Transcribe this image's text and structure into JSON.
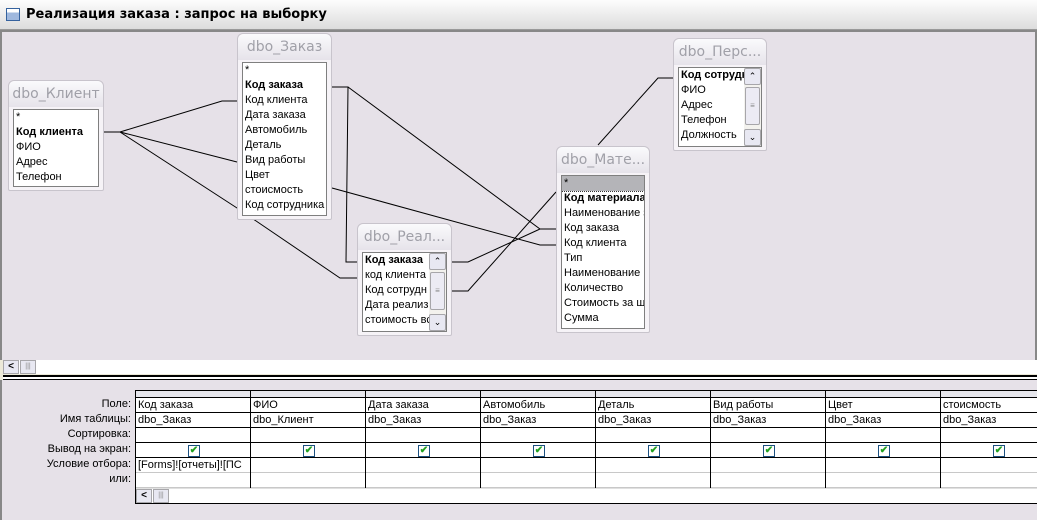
{
  "window": {
    "title": "Реализация заказа : запрос на выборку"
  },
  "tables": [
    {
      "name": "dbo_Клиент",
      "fields": [
        "*",
        "Код клиента",
        "ФИО",
        "Адрес",
        "Телефон"
      ],
      "key": 1
    },
    {
      "name": "dbo_Заказ",
      "fields": [
        "*",
        "Код заказа",
        "Код клиента",
        "Дата заказа",
        "Автомобиль",
        "Деталь",
        "Вид работы",
        "Цвет",
        "стоисмость",
        "Код сотрудника"
      ],
      "key": 1
    },
    {
      "name": "dbo_Реал...",
      "fields": [
        "Код заказа",
        "код клиента",
        "Код сотрудн",
        "Дата реализ",
        "стоимость вс"
      ],
      "key": 0
    },
    {
      "name": "dbo_Мате...",
      "fields": [
        "*",
        "Код материала",
        "Наименование з",
        "Код заказа",
        "Код клиента",
        "Тип",
        "Наименование",
        "Количество",
        "Стоимость за шт",
        "Сумма"
      ],
      "key": 1,
      "selected": 0
    },
    {
      "name": "dbo_Перс...",
      "fields": [
        "Код сотрудн",
        "ФИО",
        "Адрес",
        "Телефон",
        "Должность"
      ],
      "key": 0
    }
  ],
  "grid": {
    "row_labels": [
      "Поле:",
      "Имя таблицы:",
      "Сортировка:",
      "Вывод на экран:",
      "Условие отбора:",
      "или:"
    ],
    "columns": [
      {
        "field": "Код заказа",
        "table": "dbo_Заказ",
        "sort": "",
        "show": true,
        "criteria": "[Forms]![отчеты]![ПС",
        "or": ""
      },
      {
        "field": "ФИО",
        "table": "dbo_Клиент",
        "sort": "",
        "show": true,
        "criteria": "",
        "or": ""
      },
      {
        "field": "Дата заказа",
        "table": "dbo_Заказ",
        "sort": "",
        "show": true,
        "criteria": "",
        "or": ""
      },
      {
        "field": "Автомобиль",
        "table": "dbo_Заказ",
        "sort": "",
        "show": true,
        "criteria": "",
        "or": ""
      },
      {
        "field": "Деталь",
        "table": "dbo_Заказ",
        "sort": "",
        "show": true,
        "criteria": "",
        "or": ""
      },
      {
        "field": "Вид работы",
        "table": "dbo_Заказ",
        "sort": "",
        "show": true,
        "criteria": "",
        "or": ""
      },
      {
        "field": "Цвет",
        "table": "dbo_Заказ",
        "sort": "",
        "show": true,
        "criteria": "",
        "or": ""
      },
      {
        "field": "стоисмость",
        "table": "dbo_Заказ",
        "sort": "",
        "show": true,
        "criteria": "",
        "or": ""
      }
    ]
  }
}
